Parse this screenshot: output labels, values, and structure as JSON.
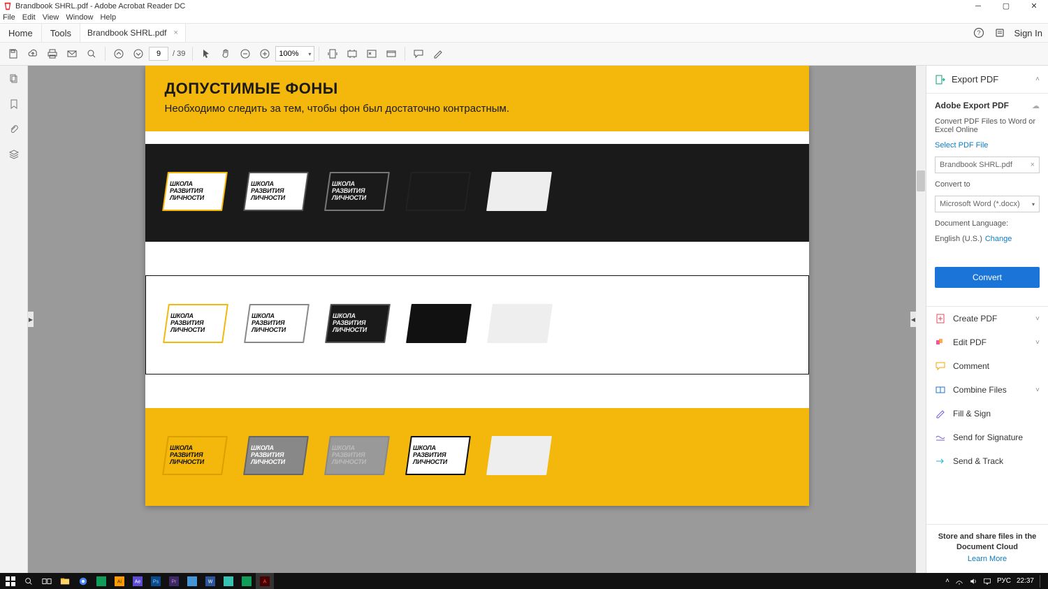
{
  "app": {
    "title": "Brandbook SHRL.pdf - Adobe Acrobat Reader DC"
  },
  "menu": {
    "file": "File",
    "edit": "Edit",
    "view": "View",
    "window": "Window",
    "help": "Help"
  },
  "tabs": {
    "home": "Home",
    "tools": "Tools",
    "doc": "Brandbook SHRL.pdf",
    "sign_in": "Sign In"
  },
  "toolbar": {
    "page_current": "9",
    "page_total": "/ 39",
    "zoom": "100%"
  },
  "page": {
    "heading": "ДОПУСТИМЫЕ ФОНЫ",
    "subheading": "Необходимо следить за тем, чтобы фон был достаточно контрастным.",
    "logo_line1": "ШКОЛА",
    "logo_line2": "РАЗВИТИЯ",
    "logo_line3": "ЛИЧНОСТИ"
  },
  "right_panel": {
    "export_pdf": "Export PDF",
    "product": "Adobe Export PDF",
    "desc": "Convert PDF Files to Word or Excel Online",
    "select_file": "Select PDF File",
    "file_name": "Brandbook SHRL.pdf",
    "convert_to": "Convert to",
    "convert_option": "Microsoft Word (*.docx)",
    "doc_lang": "Document Language:",
    "lang_value": "English (U.S.)",
    "change": "Change",
    "convert_btn": "Convert",
    "tools": {
      "create": "Create PDF",
      "edit": "Edit PDF",
      "comment": "Comment",
      "combine": "Combine Files",
      "fill": "Fill & Sign",
      "send_sig": "Send for Signature",
      "send_track": "Send & Track"
    },
    "footer1": "Store and share files in the Document Cloud",
    "footer_link": "Learn More"
  },
  "taskbar": {
    "lang": "РУС",
    "time": "22:37"
  }
}
